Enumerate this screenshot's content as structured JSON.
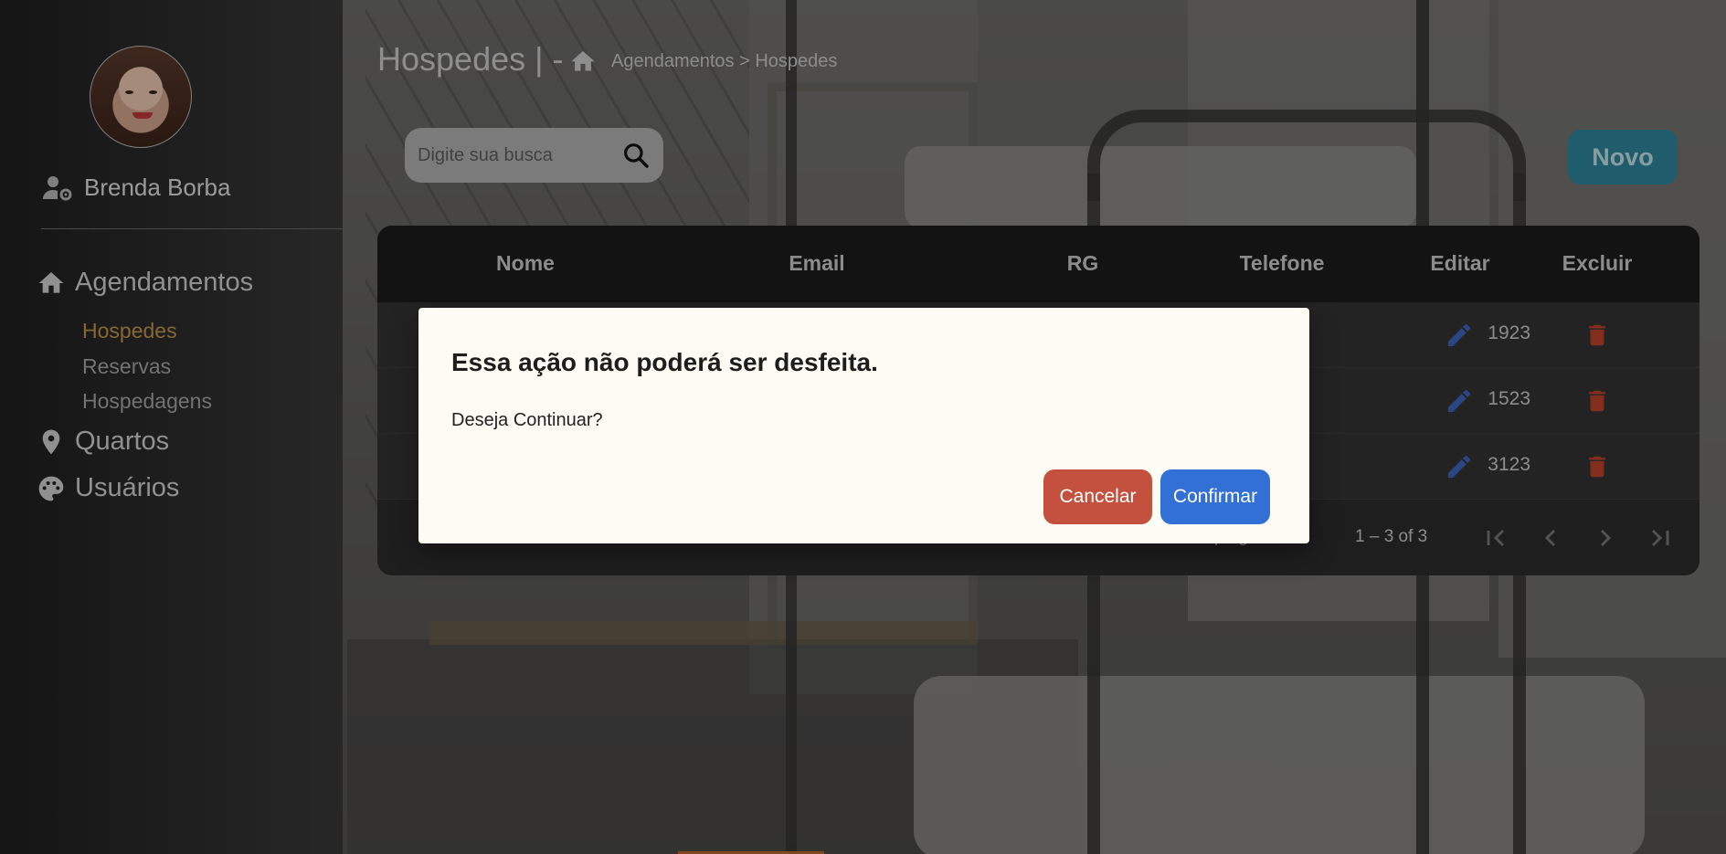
{
  "user": {
    "name": "Brenda Borba"
  },
  "nav": {
    "sections": [
      {
        "label": "Agendamentos",
        "icon": "home-icon"
      },
      {
        "label": "Quartos",
        "icon": "location-pin-icon"
      },
      {
        "label": "Usuários",
        "icon": "palette-icon"
      }
    ],
    "sub_items": [
      {
        "label": "Hospedes",
        "active": true
      },
      {
        "label": "Reservas",
        "active": false
      },
      {
        "label": "Hospedagens",
        "active": false
      }
    ]
  },
  "header": {
    "title": "Hospedes | -",
    "breadcrumb": "Agendamentos > Hospedes"
  },
  "search": {
    "placeholder": "Digite sua busca"
  },
  "toolbar": {
    "new_label": "Novo"
  },
  "table": {
    "columns": [
      "Nome",
      "Email",
      "RG",
      "Telefone",
      "Editar",
      "Excluir"
    ],
    "rows": [
      {
        "telefone_visible": "1923"
      },
      {
        "telefone_visible": "1523"
      },
      {
        "telefone_visible": "3123"
      }
    ],
    "footer": {
      "per_page_label": "...p...g...",
      "range": "1 – 3 of 3"
    }
  },
  "dialog": {
    "title": "Essa ação não poderá ser desfeita.",
    "message": "Deseja Continuar?",
    "cancel_label": "Cancelar",
    "confirm_label": "Confirmar"
  },
  "colors": {
    "accent_active": "#c59a4d",
    "new_button": "#2f8aa0",
    "cancel_button": "#c4513e",
    "confirm_button": "#3370d6",
    "edit_icon": "#3f68c4",
    "delete_icon": "#c0452f"
  }
}
